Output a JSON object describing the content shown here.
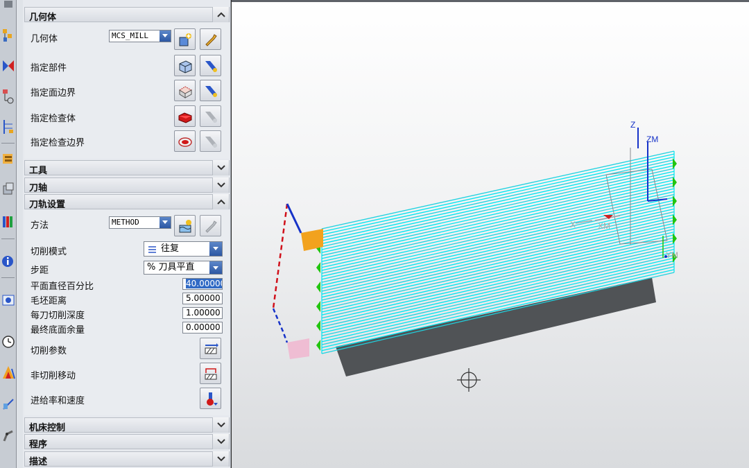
{
  "toolbar": {
    "icons": [
      "geometry-tool-icon",
      "mirror-tool-icon",
      "operation-tool-icon",
      "machine-tool-icon",
      "method-tool-icon",
      "part-view-icon",
      "library-icon",
      "info-icon",
      "display-icon",
      "clock-icon",
      "color-palette-icon",
      "analysis-icon",
      "robot-arm-icon"
    ]
  },
  "panel": {
    "geometry": {
      "title": "几何体",
      "geometry_label": "几何体",
      "geometry_value": "MCS_MILL",
      "specify_part": "指定部件",
      "specify_face_boundary": "指定面边界",
      "specify_check_body": "指定检查体",
      "specify_check_boundary": "指定检查边界"
    },
    "tool": {
      "title": "工具"
    },
    "tool_axis": {
      "title": "刀轴"
    },
    "path_settings": {
      "title": "刀轨设置",
      "method_label": "方法",
      "method_value": "METHOD",
      "cut_pattern_label": "切削模式",
      "cut_pattern_value": "往复",
      "stepover_label": "步距",
      "stepover_value": "% 刀具平直",
      "percent_label": "平面直径百分比",
      "percent_value": "40.00000",
      "blank_distance_label": "毛坯距离",
      "blank_distance_value": "5.00000",
      "depth_per_cut_label": "每刀切削深度",
      "depth_per_cut_value": "1.00000",
      "final_floor_stock_label": "最终底面余量",
      "final_floor_stock_value": "0.00000",
      "cutting_params_label": "切削参数",
      "non_cutting_label": "非切削移动",
      "feeds_speeds_label": "进给率和速度"
    },
    "machine_control": {
      "title": "机床控制"
    },
    "program": {
      "title": "程序"
    },
    "description": {
      "title": "描述"
    }
  },
  "viewport": {
    "axis_labels": {
      "z": "Z",
      "zm": "ZM",
      "x": "X",
      "xm": "XM",
      "ym": "YM"
    }
  },
  "colors": {
    "toolpath": "#00e5f0",
    "solid": "#505356",
    "engage": "#22c50f",
    "rapid": "#d0101a",
    "axis_blue": "#1632c8"
  }
}
